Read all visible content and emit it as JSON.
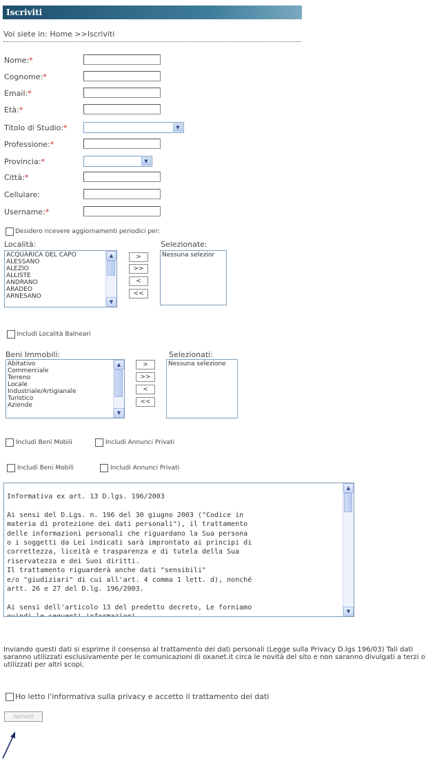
{
  "header": {
    "title": "Iscriviti"
  },
  "breadcrumb": "Voi siete in: Home >>Iscriviti",
  "required_marker": "*",
  "fields": {
    "nome": "Nome:",
    "cognome": "Cognome:",
    "email": "Email:",
    "eta": "Età:",
    "titolo_studio": "Titolo di Studio:",
    "professione": "Professione:",
    "provincia": "Provincia:",
    "citta": "Città:",
    "cellulare": "Cellulare:",
    "username": "Username:"
  },
  "updates_checkbox": "Desidero ricevere aggiornamenti periodici per:",
  "localita": {
    "label": "Località:",
    "items": [
      "ACQUARICA DEL CAPO",
      "ALESSANO",
      "ALEZIO",
      "ALLISTE",
      "ANDRANO",
      "ARADEO",
      "ARNESANO"
    ],
    "selected_label": "Selezionate:",
    "selected_placeholder": "Nessuna selezior"
  },
  "move_buttons": {
    "add": ">",
    "add_all": ">>",
    "remove": "<",
    "remove_all": "<<"
  },
  "include_balneari": "Includi Località Balneari",
  "beni": {
    "label": "Beni Immobili:",
    "items": [
      "Abitativo",
      "Commerciale",
      "Terreno",
      "Locale",
      "Industriale/Artigianale",
      "Turistico",
      "Aziende"
    ],
    "selected_label": "Selezionati:",
    "selected_placeholder": "Nessuna selezione"
  },
  "checkboxes": {
    "beni_mobili": "Includi Beni Mobili",
    "annunci_privati": "Includi Annunci Privati"
  },
  "privacy_text": "Informativa ex art. 13 D.lgs. 196/2003\n\nAi sensi del D.Lgs. n. 196 del 30 giugno 2003 (\"Codice in\nmateria di protezione dei dati personali\"), il trattamento\ndelle informazioni personali che riguardano la Sua persona\no i soggetti da Lei indicati sarà improntato ai principi di\ncorrettezza, liceità e trasparenza e di tutela della Sua\nriservatezza e dei Suoi diritti.\nIl trattamento riguarderà anche dati \"sensibili\"\ne/o \"giudiziari\" di cui all'art. 4 comma 1 lett. d), nonché\nartt. 26 e 27 del D.lg. 196/2003.\n\nAi sensi dell'articolo 13 del predetto decreto, Le forniamo\nquindi le seguenti informazioni.",
  "consent_text": "Inviando questi dati si esprime il consenso al trattamento dei dati personali (Legge sulla Privacy D.lgs 196/03) Tali dati saranno utilizzati esclusivamente per le comunicazioni di oxanet.it circa le novità del sito e non saranno divulgati a terzi o utilizzati per altri scopi.",
  "privacy_accept": "Ho letto l'informativa sulla privacy e accetto il trattamento dei dati",
  "submit_label": "Iscriviti"
}
